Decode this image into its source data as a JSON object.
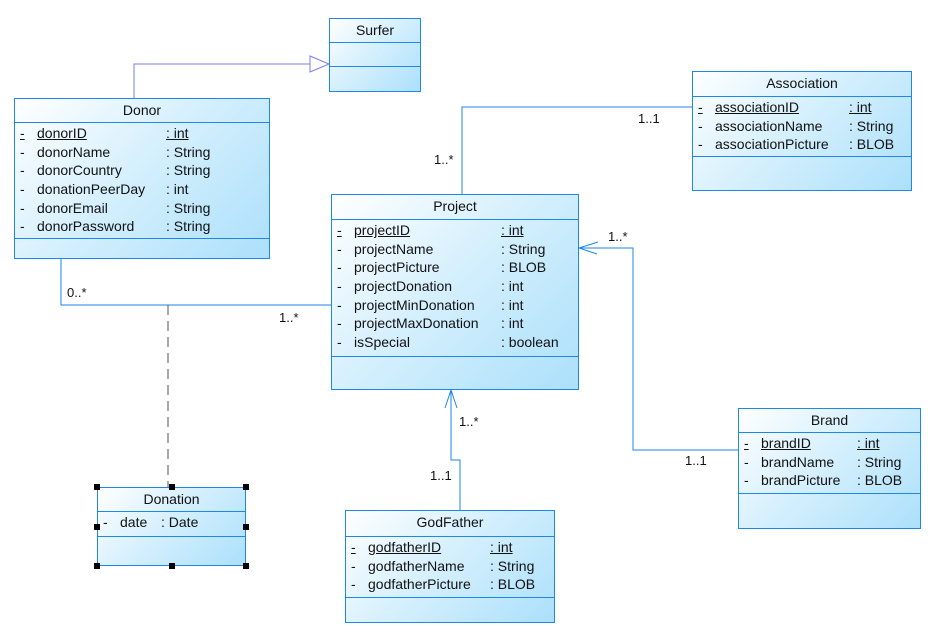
{
  "colors": {
    "border": "#1f86ea",
    "generalization": "#7b7bf0",
    "fill_light": "#ffffff",
    "fill_dark": "#ace0fb"
  },
  "classes": [
    {
      "name": "Surfer",
      "attributes": []
    },
    {
      "name": "Donor",
      "attributes": [
        {
          "vis": "-",
          "name": "donorID",
          "type": ": int",
          "key": true
        },
        {
          "vis": "-",
          "name": "donorName",
          "type": ": String"
        },
        {
          "vis": "-",
          "name": "donorCountry",
          "type": ": String"
        },
        {
          "vis": "-",
          "name": "donationPeerDay",
          "type": ": int"
        },
        {
          "vis": "-",
          "name": "donorEmail",
          "type": ": String"
        },
        {
          "vis": "-",
          "name": "donorPassword",
          "type": ": String"
        }
      ]
    },
    {
      "name": "Association",
      "attributes": [
        {
          "vis": "-",
          "name": "associationID",
          "type": ": int",
          "key": true
        },
        {
          "vis": "-",
          "name": "associationName",
          "type": ": String"
        },
        {
          "vis": "-",
          "name": "associationPicture",
          "type": ": BLOB"
        }
      ]
    },
    {
      "name": "Project",
      "attributes": [
        {
          "vis": "-",
          "name": "projectID",
          "type": ": int",
          "key": true
        },
        {
          "vis": "-",
          "name": "projectName",
          "type": ": String"
        },
        {
          "vis": "-",
          "name": "projectPicture",
          "type": ": BLOB"
        },
        {
          "vis": "-",
          "name": "projectDonation",
          "type": ": int"
        },
        {
          "vis": "-",
          "name": "projectMinDonation",
          "type": ": int"
        },
        {
          "vis": "-",
          "name": "projectMaxDonation",
          "type": ": int"
        },
        {
          "vis": "-",
          "name": "isSpecial",
          "type": ": boolean"
        }
      ]
    },
    {
      "name": "Brand",
      "attributes": [
        {
          "vis": "-",
          "name": "brandID",
          "type": ": int",
          "key": true
        },
        {
          "vis": "-",
          "name": "brandName",
          "type": ": String"
        },
        {
          "vis": "-",
          "name": "brandPicture",
          "type": ": BLOB"
        }
      ]
    },
    {
      "name": "GodFather",
      "attributes": [
        {
          "vis": "-",
          "name": "godfatherID",
          "type": ": int",
          "key": true
        },
        {
          "vis": "-",
          "name": "godfatherName",
          "type": ": String"
        },
        {
          "vis": "-",
          "name": "godfatherPicture",
          "type": ": BLOB"
        }
      ]
    },
    {
      "name": "Donation",
      "selected": true,
      "attributes": [
        {
          "vis": "-",
          "name": "date",
          "type": ": Date"
        }
      ]
    }
  ],
  "relations": [
    {
      "type": "generalization",
      "from": "Donor",
      "to": "Surfer",
      "labels": []
    },
    {
      "type": "association",
      "from": "Project",
      "to": "Association",
      "labels": [
        "1..*",
        "1..1"
      ]
    },
    {
      "type": "association",
      "from": "Donor",
      "to": "Project",
      "labels": [
        "0..*",
        "1..*"
      ]
    },
    {
      "type": "association-class",
      "from": "Donation",
      "to": "Donor-Project",
      "labels": []
    },
    {
      "type": "directed-association",
      "from": "Brand",
      "to": "Project",
      "labels": [
        "1..*",
        "1..1"
      ]
    },
    {
      "type": "directed-association",
      "from": "GodFather",
      "to": "Project",
      "labels": [
        "1..*",
        "1..1"
      ]
    }
  ]
}
